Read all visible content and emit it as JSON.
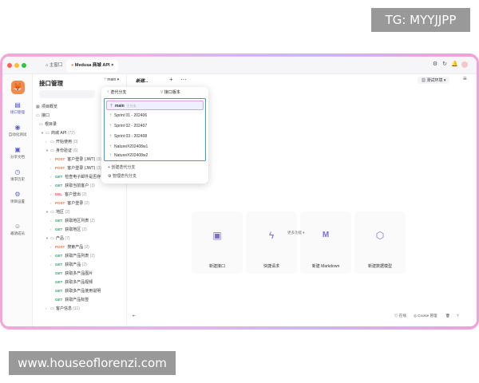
{
  "overlays": {
    "top_badge": "TG: MYYJJPP",
    "bottom_badge": "www.houseoflorenzi.com"
  },
  "colors": {
    "accent": "#4a50d8",
    "highlight_border": "#2aa3dd",
    "post": "#e8743b",
    "get": "#2fa36b",
    "delete": "#e05252"
  },
  "titlebar": {
    "tabs": [
      {
        "label": "主窗口",
        "icon": "home-icon"
      },
      {
        "label": "Medusa 商城 API",
        "icon": "app-icon"
      }
    ],
    "right_icons": [
      "settings-icon",
      "refresh-icon",
      "bell-icon",
      "avatar"
    ]
  },
  "rail": {
    "items": [
      {
        "label": "接口管理",
        "icon": "api-icon"
      },
      {
        "label": "自动化测试",
        "icon": "test-icon"
      },
      {
        "label": "分享文档",
        "icon": "doc-icon"
      },
      {
        "label": "请求历史",
        "icon": "history-icon"
      },
      {
        "label": "项目设置",
        "icon": "settings-icon"
      },
      {
        "label": "邀请成员",
        "icon": "invite-icon"
      }
    ]
  },
  "left_panel": {
    "title": "接口管理",
    "tree": [
      {
        "label": "项目概览"
      },
      {
        "label": "接口"
      },
      {
        "label": "根目录"
      },
      {
        "label": "商城 API",
        "count": "(72)"
      },
      {
        "label": "开始使用",
        "count": "(0)"
      },
      {
        "label": "身份验证",
        "count": "(6)"
      },
      {
        "method": "POST",
        "label": "客户登录 (JWT)",
        "count": "(3)"
      },
      {
        "method": "POST",
        "label": "客户登录 (JWT)",
        "count": "(3)"
      },
      {
        "method": "GET",
        "label": "检查电子邮件是否存"
      },
      {
        "method": "GET",
        "label": "获取当前客户",
        "count": "(3)"
      },
      {
        "method": "DEL",
        "label": "客户登出",
        "count": "(2)"
      },
      {
        "method": "POST",
        "label": "客户登录",
        "count": "(2)"
      },
      {
        "label": "地区",
        "count": "(2)"
      },
      {
        "method": "GET",
        "label": "获取地区列表",
        "count": "(2)"
      },
      {
        "method": "GET",
        "label": "获取地区",
        "count": "(2)"
      },
      {
        "label": "产品",
        "count": "(7)"
      },
      {
        "method": "POST",
        "label": "搜索产品",
        "count": "(2)"
      },
      {
        "method": "GET",
        "label": "获取产品列表",
        "count": "(2)"
      },
      {
        "method": "GET",
        "label": "获取产品",
        "count": "(2)"
      },
      {
        "method": "GET",
        "label": "获取多产品图片"
      },
      {
        "method": "GET",
        "label": "获取多产品视频"
      },
      {
        "method": "GET",
        "label": "获取多产品使用说明"
      },
      {
        "method": "GET",
        "label": "获取产品标签"
      },
      {
        "label": "客户信息",
        "count": "(11)"
      }
    ]
  },
  "toolbar": {
    "branch": "main",
    "new_tab": "新建...",
    "environment": "测试环境"
  },
  "dropdown": {
    "tabs": [
      "迭代分支",
      "接口版本"
    ],
    "branches": [
      {
        "name": "main",
        "tag": "主分支"
      },
      {
        "name": "Sprint 01 - 202406"
      },
      {
        "name": "Sprint 02 - 202407"
      },
      {
        "name": "Sprint 03 - 202408"
      },
      {
        "name": "Nature/#202408w1"
      },
      {
        "name": "Nature/#202408w2"
      }
    ],
    "actions": [
      "创建迭代分支",
      "管理迭代分支"
    ]
  },
  "cards": [
    {
      "label": "新建接口",
      "icon": "new-api-icon"
    },
    {
      "label": "快捷请求",
      "icon": "bolt-icon"
    },
    {
      "label": "新建 Markdown",
      "icon": "markdown-icon"
    },
    {
      "label": "新建数据模型",
      "icon": "cube-icon"
    }
  ],
  "more_features": "更多功能",
  "status": {
    "online": "在线",
    "cookie": "Cookie 管理"
  }
}
